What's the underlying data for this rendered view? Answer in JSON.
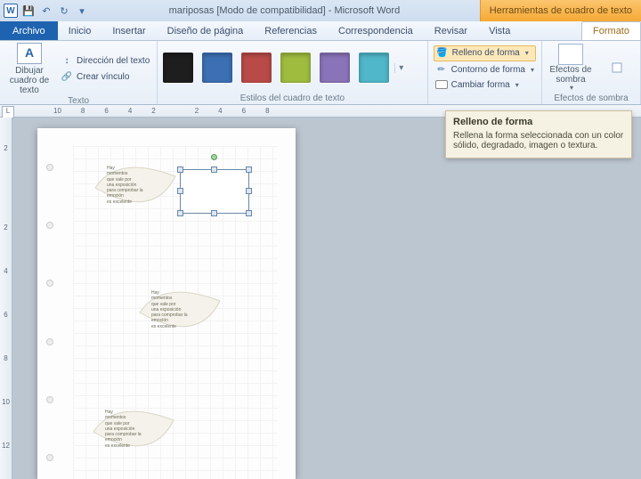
{
  "title_bar": {
    "app_letter": "W",
    "doc_title": "mariposas [Modo de compatibilidad] - Microsoft Word",
    "contextual_tab_title": "Herramientas de cuadro de texto"
  },
  "tabs": {
    "file": "Archivo",
    "home": "Inicio",
    "insert": "Insertar",
    "layout": "Diseño de página",
    "references": "Referencias",
    "mail": "Correspondencia",
    "review": "Revisar",
    "view": "Vista",
    "format": "Formato"
  },
  "ribbon": {
    "draw_textbox": "Dibujar cuadro de texto",
    "text_direction": "Dirección del texto",
    "create_link": "Crear vínculo",
    "group_text": "Texto",
    "group_styles": "Estilos del cuadro de texto",
    "shape_fill": "Relleno de forma",
    "shape_outline": "Contorno de forma",
    "change_shape": "Cambiar forma",
    "shadow_effects": "Efectos de sombra",
    "shadow_effects2": "Efectos de sombra"
  },
  "ruler_h": [
    "10",
    "8",
    "6",
    "4",
    "2",
    "",
    "2",
    "4",
    "6",
    "8"
  ],
  "ruler_v": [
    "2",
    "",
    "2",
    "4",
    "6",
    "8",
    "10",
    "12"
  ],
  "tooltip": {
    "title": "Relleno de forma",
    "body": "Rellena la forma seleccionada con un color sólido, degradado, imagen o textura."
  },
  "leaf_lines": [
    "Hay",
    "momentos",
    "que vale por",
    "una exposición",
    "para comprobar la",
    "emoción",
    "es excelente"
  ]
}
